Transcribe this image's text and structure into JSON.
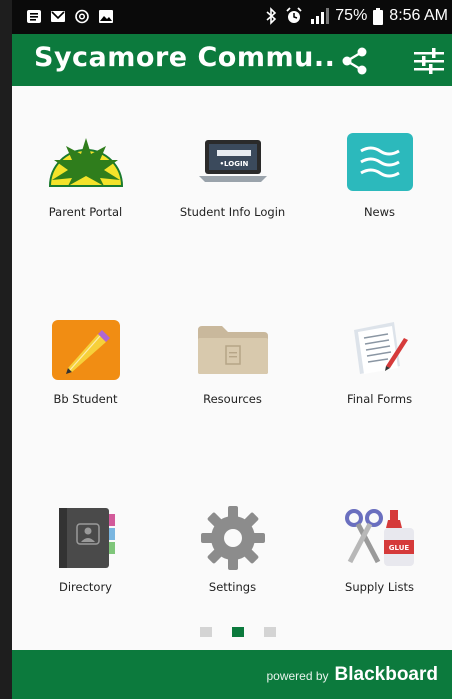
{
  "status_bar": {
    "battery": "75%",
    "time": "8:56 AM",
    "left_icons": [
      "notification-icon",
      "gmail-icon",
      "at-icon",
      "image-icon"
    ],
    "right_icons": [
      "bluetooth-icon",
      "alarm-icon",
      "signal-icon",
      "battery-icon"
    ]
  },
  "app_bar": {
    "title": "Sycamore Commu..",
    "bg_color": "#0c7a3d"
  },
  "tiles": [
    {
      "label": "Parent Portal",
      "icon": "parent-portal-icon"
    },
    {
      "label": "Student Info Login",
      "icon": "login-laptop-icon"
    },
    {
      "label": "News",
      "icon": "news-waves-icon"
    },
    {
      "label": "Bb Student",
      "icon": "bb-student-pencil-icon"
    },
    {
      "label": "Resources",
      "icon": "folder-icon"
    },
    {
      "label": "Final Forms",
      "icon": "forms-icon"
    },
    {
      "label": "Directory",
      "icon": "address-book-icon"
    },
    {
      "label": "Settings",
      "icon": "gear-icon"
    },
    {
      "label": "Supply Lists",
      "icon": "scissors-glue-icon"
    }
  ],
  "pager": {
    "count": 3,
    "active": 2
  },
  "footer": {
    "powered_by": "powered by",
    "brand": "Blackboard"
  }
}
